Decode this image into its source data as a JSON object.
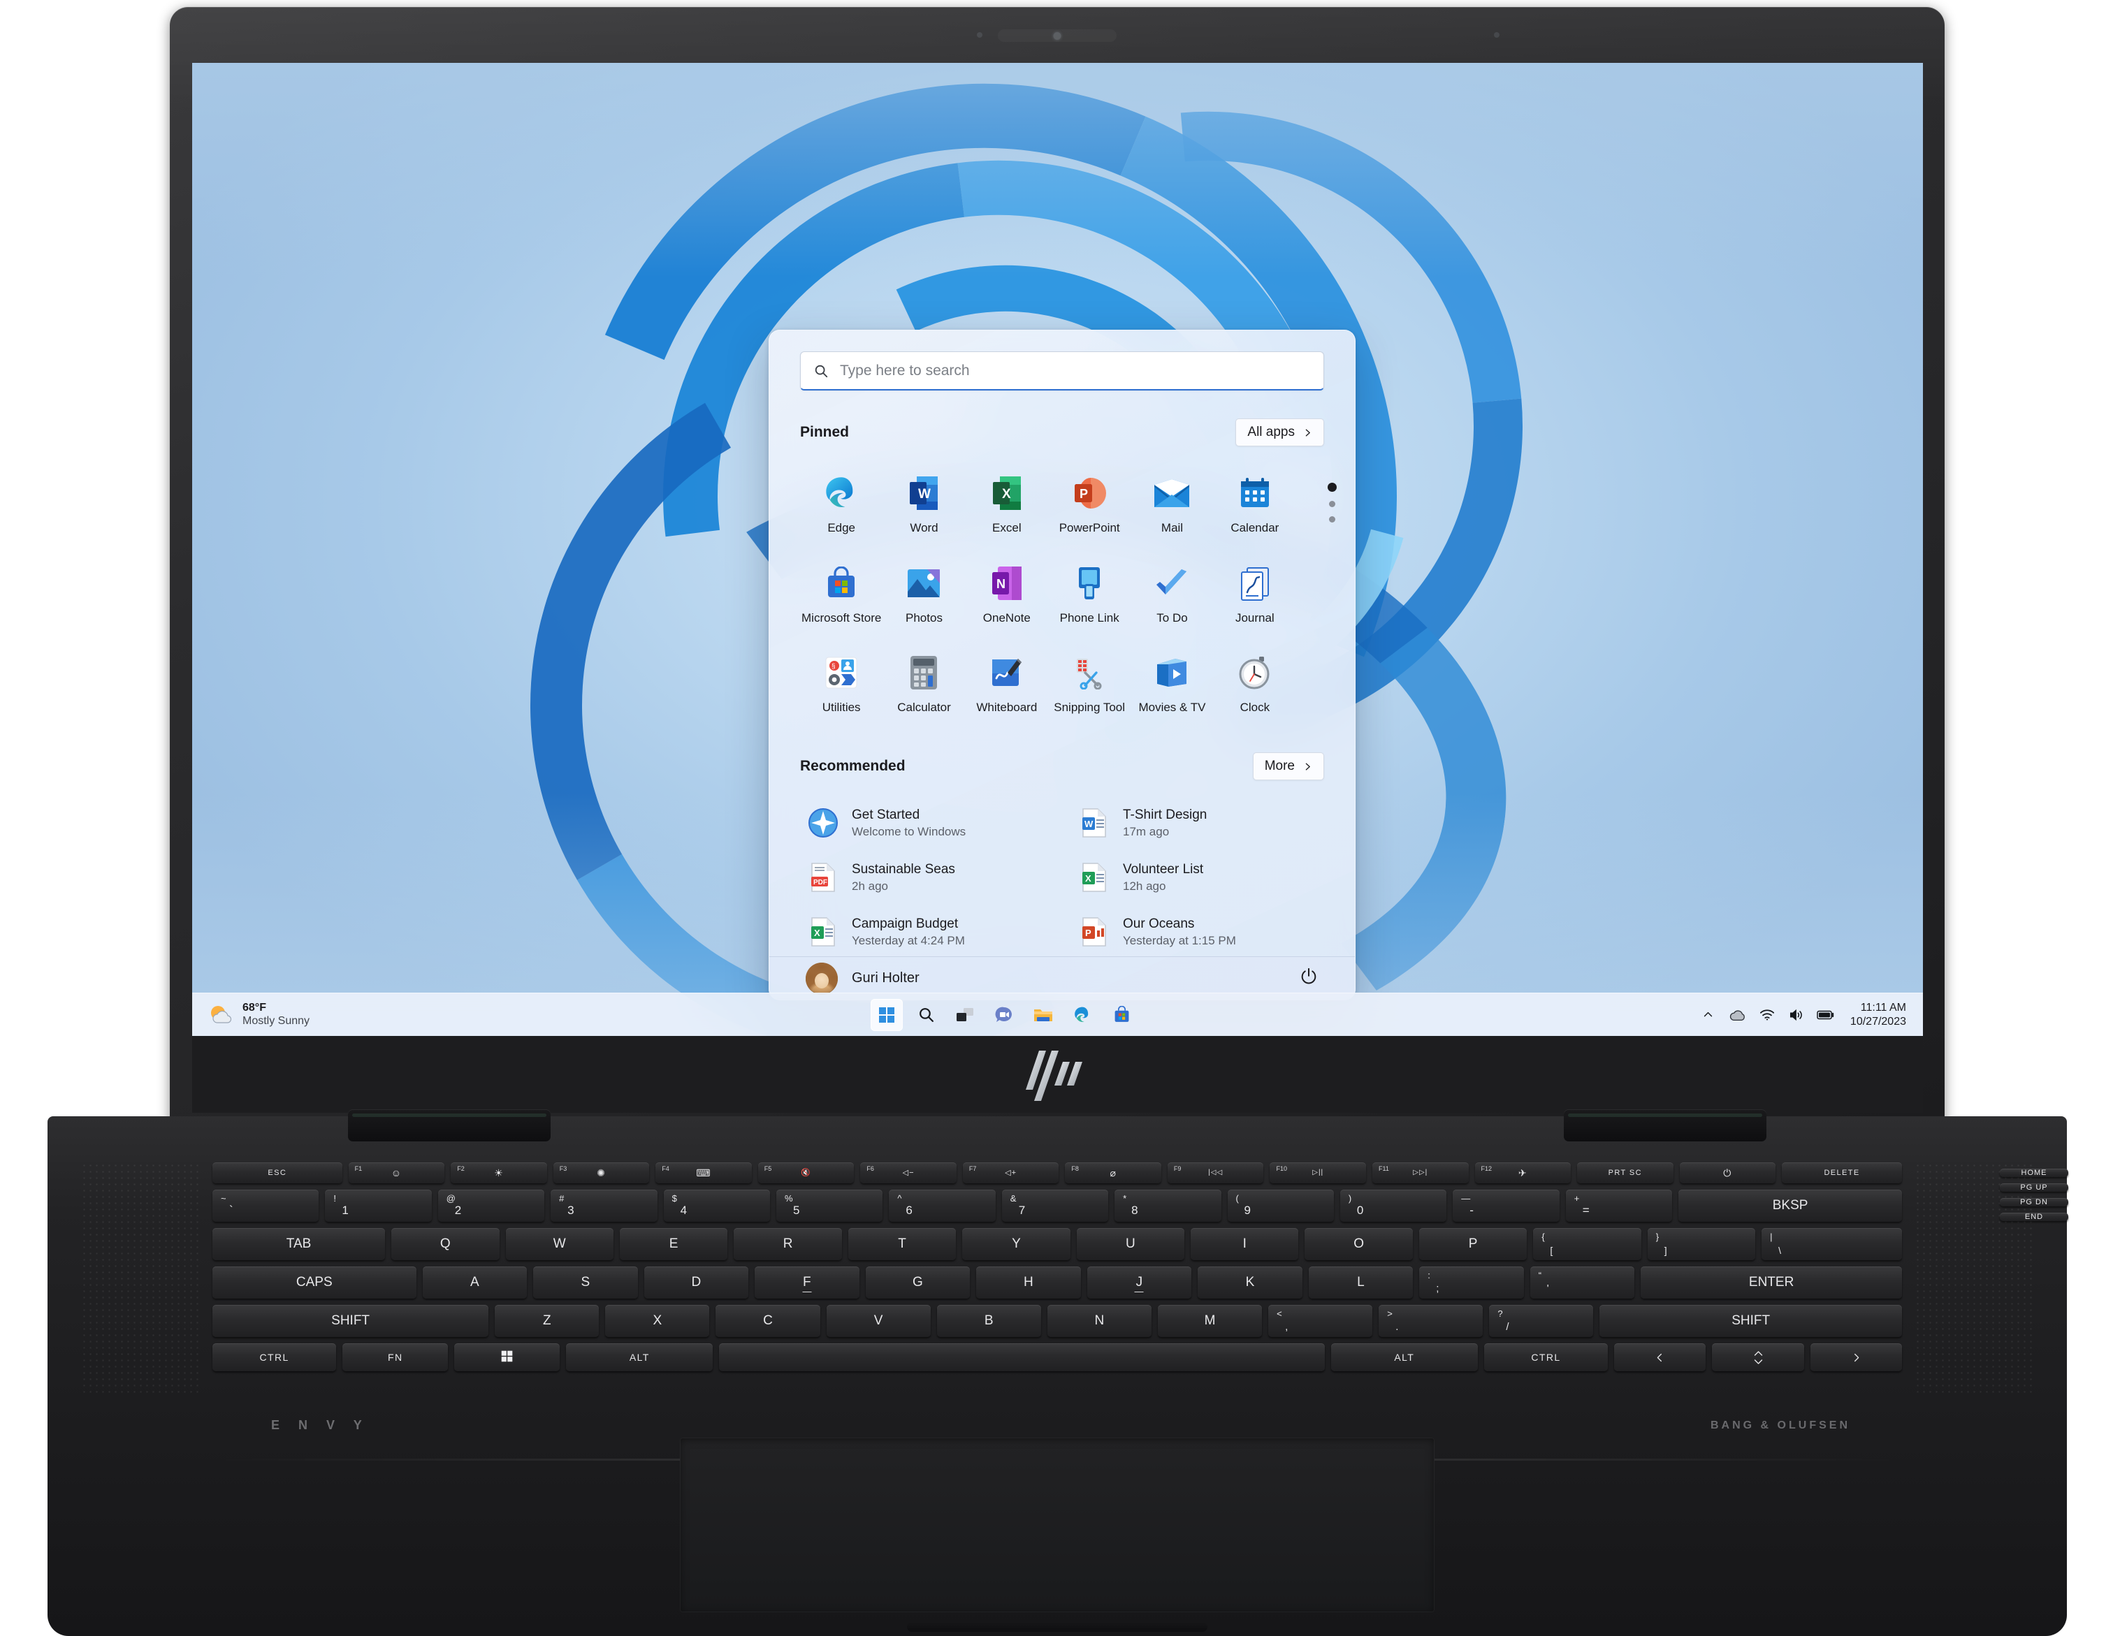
{
  "device": {
    "brand_logo": "hp-logo",
    "keyboard_brand": "E N V Y",
    "audio_brand": "BANG & OLUFSEN"
  },
  "start_menu": {
    "search": {
      "placeholder": "Type here to search",
      "icon": "search-icon"
    },
    "pinned": {
      "title": "Pinned",
      "all_apps_label": "All apps",
      "all_apps_chevron": "chevron-right-icon",
      "apps": [
        {
          "label": "Edge",
          "icon": "edge-icon"
        },
        {
          "label": "Word",
          "icon": "word-icon"
        },
        {
          "label": "Excel",
          "icon": "excel-icon"
        },
        {
          "label": "PowerPoint",
          "icon": "powerpoint-icon"
        },
        {
          "label": "Mail",
          "icon": "mail-icon"
        },
        {
          "label": "Calendar",
          "icon": "calendar-icon"
        },
        {
          "label": "Microsoft Store",
          "icon": "microsoft-store-icon"
        },
        {
          "label": "Photos",
          "icon": "photos-icon"
        },
        {
          "label": "OneNote",
          "icon": "onenote-icon"
        },
        {
          "label": "Phone Link",
          "icon": "phone-link-icon"
        },
        {
          "label": "To Do",
          "icon": "to-do-icon"
        },
        {
          "label": "Journal",
          "icon": "journal-icon"
        },
        {
          "label": "Utilities",
          "icon": "utilities-folder-icon"
        },
        {
          "label": "Calculator",
          "icon": "calculator-icon"
        },
        {
          "label": "Whiteboard",
          "icon": "whiteboard-icon"
        },
        {
          "label": "Snipping Tool",
          "icon": "snipping-tool-icon"
        },
        {
          "label": "Movies & TV",
          "icon": "movies-tv-icon"
        },
        {
          "label": "Clock",
          "icon": "clock-icon"
        }
      ],
      "pages": 3,
      "active_page": 1
    },
    "recommended": {
      "title": "Recommended",
      "more_label": "More",
      "more_chevron": "chevron-right-icon",
      "items": [
        {
          "title": "Get Started",
          "subtitle": "Welcome to Windows",
          "icon": "get-started-icon"
        },
        {
          "title": "T-Shirt Design",
          "subtitle": "17m ago",
          "icon": "word-doc-icon"
        },
        {
          "title": "Sustainable Seas",
          "subtitle": "2h ago",
          "icon": "pdf-doc-icon"
        },
        {
          "title": "Volunteer List",
          "subtitle": "12h ago",
          "icon": "excel-doc-icon"
        },
        {
          "title": "Campaign Budget",
          "subtitle": "Yesterday at 4:24 PM",
          "icon": "excel-doc-icon"
        },
        {
          "title": "Our Oceans",
          "subtitle": "Yesterday at 1:15 PM",
          "icon": "powerpoint-doc-icon"
        }
      ]
    },
    "account": {
      "name": "Guri Holter",
      "avatar": "user-avatar",
      "power_icon": "power-icon"
    }
  },
  "taskbar": {
    "weather": {
      "temperature": "68°F",
      "condition": "Mostly Sunny",
      "icon": "sun-cloud-icon"
    },
    "buttons": [
      {
        "name": "start-button",
        "icon": "windows-logo-icon",
        "active": true
      },
      {
        "name": "search-button",
        "icon": "search-icon",
        "active": false
      },
      {
        "name": "task-view-button",
        "icon": "task-view-icon",
        "active": false
      },
      {
        "name": "chat-button",
        "icon": "chat-icon",
        "active": false
      },
      {
        "name": "file-explorer-button",
        "icon": "folder-icon",
        "active": false
      },
      {
        "name": "edge-button",
        "icon": "edge-icon",
        "active": false
      },
      {
        "name": "store-button",
        "icon": "microsoft-store-icon",
        "active": false
      }
    ],
    "tray": {
      "show_hidden_icon": "chevron-up-icon",
      "onedrive_icon": "cloud-icon",
      "wifi_icon": "wifi-icon",
      "volume_icon": "speaker-icon",
      "battery_icon": "battery-icon",
      "time": "11:11 AM",
      "date": "10/27/2023"
    }
  },
  "keyboard": {
    "fn_row": [
      {
        "label": "ESC"
      },
      {
        "fnum": "F1",
        "glyph": "☺"
      },
      {
        "fnum": "F2",
        "glyph": "☀"
      },
      {
        "fnum": "F3",
        "glyph": "✺"
      },
      {
        "fnum": "F4",
        "glyph": "⌨"
      },
      {
        "fnum": "F5",
        "glyph": "🔇"
      },
      {
        "fnum": "F6",
        "glyph": "◁−"
      },
      {
        "fnum": "F7",
        "glyph": "◁+"
      },
      {
        "fnum": "F8",
        "glyph": "⌀"
      },
      {
        "fnum": "F9",
        "glyph": "|◁◁"
      },
      {
        "fnum": "F10",
        "glyph": "▷||"
      },
      {
        "fnum": "F11",
        "glyph": "▷▷|"
      },
      {
        "fnum": "F12",
        "glyph": "✈"
      },
      {
        "label": "PRT SC"
      },
      {
        "glyph": "⏻"
      },
      {
        "label": "DELETE"
      }
    ],
    "number_row": [
      {
        "sup": "~",
        "sub": "`"
      },
      {
        "sup": "!",
        "sub": "1"
      },
      {
        "sup": "@",
        "sub": "2"
      },
      {
        "sup": "#",
        "sub": "3"
      },
      {
        "sup": "$",
        "sub": "4"
      },
      {
        "sup": "%",
        "sub": "5"
      },
      {
        "sup": "^",
        "sub": "6"
      },
      {
        "sup": "&",
        "sub": "7"
      },
      {
        "sup": "*",
        "sub": "8"
      },
      {
        "sup": "(",
        "sub": "9"
      },
      {
        "sup": ")",
        "sub": "0"
      },
      {
        "sup": "—",
        "sub": "-"
      },
      {
        "sup": "+",
        "sub": "="
      },
      {
        "label": "BKSP"
      }
    ],
    "qwerty_row": [
      "TAB",
      "Q",
      "W",
      "E",
      "R",
      "T",
      "Y",
      "U",
      "I",
      "O",
      "P",
      "[",
      "]",
      "\\"
    ],
    "home_row": [
      "CAPS",
      "A",
      "S",
      "D",
      "F",
      "G",
      "H",
      "J",
      "K",
      "L",
      ";",
      "'",
      "ENTER"
    ],
    "shift_row": [
      "SHIFT",
      "Z",
      "X",
      "C",
      "V",
      "B",
      "N",
      "M",
      ",",
      ".",
      "/",
      "SHIFT"
    ],
    "bottom_row": [
      "CTRL",
      "FN",
      "⊞",
      "ALT",
      "",
      "ALT",
      "CTRL",
      "<",
      "^ v",
      ">"
    ],
    "right_column": [
      "HOME",
      "PG UP",
      "PG DN",
      "END"
    ]
  }
}
